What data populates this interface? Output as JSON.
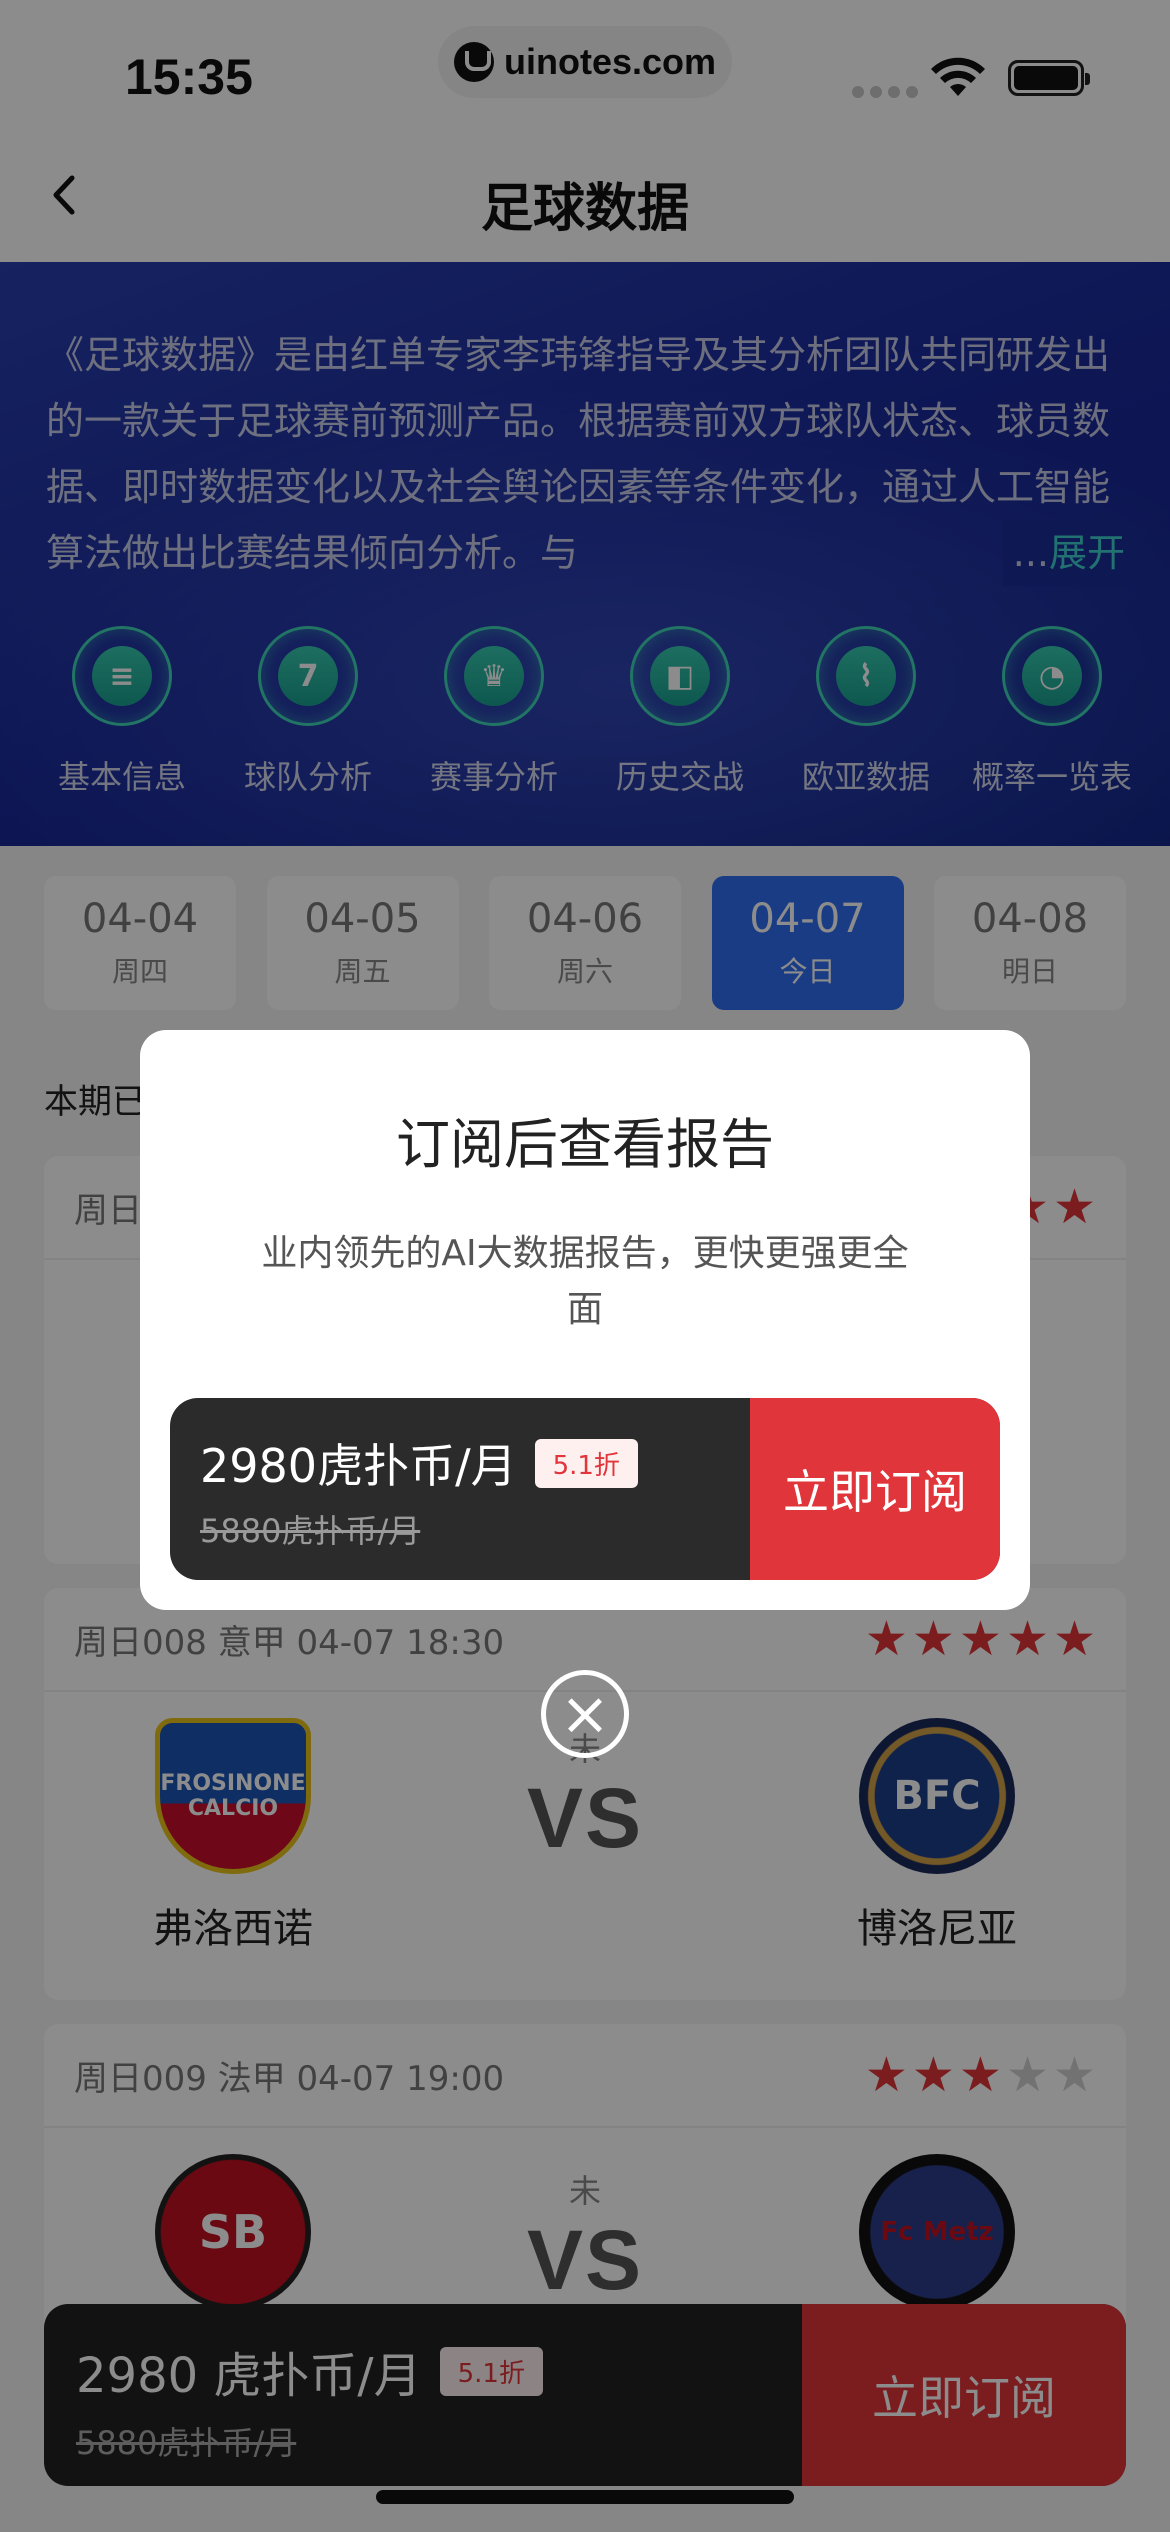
{
  "status_bar": {
    "time": "15:35",
    "url": "uinotes.com"
  },
  "nav": {
    "title": "足球数据"
  },
  "hero": {
    "description": "《足球数据》是由红单专家李玮锋指导及其分析团队共同研发出的一款关于足球赛前预测产品。根据赛前双方球队状态、球员数据、即时数据变化以及社会舆论因素等条件变化，通过人工智能算法做出比赛结果倾向分析。与",
    "ellipsis": "...",
    "expand_label": "展开",
    "features": [
      {
        "label": "基本信息",
        "icon": "document-icon",
        "glyph": "≡"
      },
      {
        "label": "球队分析",
        "icon": "jersey-icon",
        "glyph": "7"
      },
      {
        "label": "赛事分析",
        "icon": "trophy-icon",
        "glyph": "♛"
      },
      {
        "label": "历史交战",
        "icon": "book-icon",
        "glyph": "◧"
      },
      {
        "label": "欧亚数据",
        "icon": "chart-line-icon",
        "glyph": "⌇"
      },
      {
        "label": "概率一览表",
        "icon": "pie-chart-icon",
        "glyph": "◔"
      }
    ]
  },
  "dates": [
    {
      "date": "04-04",
      "weekday": "周四"
    },
    {
      "date": "04-05",
      "weekday": "周五"
    },
    {
      "date": "04-06",
      "weekday": "周六"
    },
    {
      "date": "04-07",
      "weekday": "今日"
    },
    {
      "date": "04-08",
      "weekday": "明日"
    }
  ],
  "section_label": "本期已",
  "matches": [
    {
      "info": "周日",
      "stars": 5,
      "home": {
        "name": "",
        "crest": ""
      },
      "away": {
        "name": "",
        "crest": ""
      },
      "status": "",
      "vs": ""
    },
    {
      "info": "周日008 意甲 04-07 18:30",
      "stars": 5,
      "home": {
        "name": "弗洛西诺",
        "crest": "FROSINONE CALCIO"
      },
      "away": {
        "name": "博洛尼亚",
        "crest": "BFC"
      },
      "status": "未",
      "vs": "VS"
    },
    {
      "info": "周日009 法甲 04-07 19:00",
      "stars": 3,
      "home": {
        "name": "",
        "crest": "SB"
      },
      "away": {
        "name": "",
        "crest": "Fc Metz"
      },
      "status": "未",
      "vs": "VS"
    }
  ],
  "bottom_bar": {
    "price": "2980 虎扑币/月",
    "discount": "5.1折",
    "original_price": "5880虎扑币/月",
    "button": "立即订阅"
  },
  "modal": {
    "title": "订阅后查看报告",
    "description": "业内领先的AI大数据报告，更快更强更全面",
    "price": "2980虎扑币/月",
    "discount": "5.1折",
    "original_price": "5880虎扑币/月",
    "button": "立即订阅",
    "close_glyph": "×"
  },
  "colors": {
    "accent_red": "#e0353a",
    "active_date_blue": "#2f6ef0",
    "hero_blue": "#1a2a9a",
    "feature_teal": "#3fd3b6"
  }
}
